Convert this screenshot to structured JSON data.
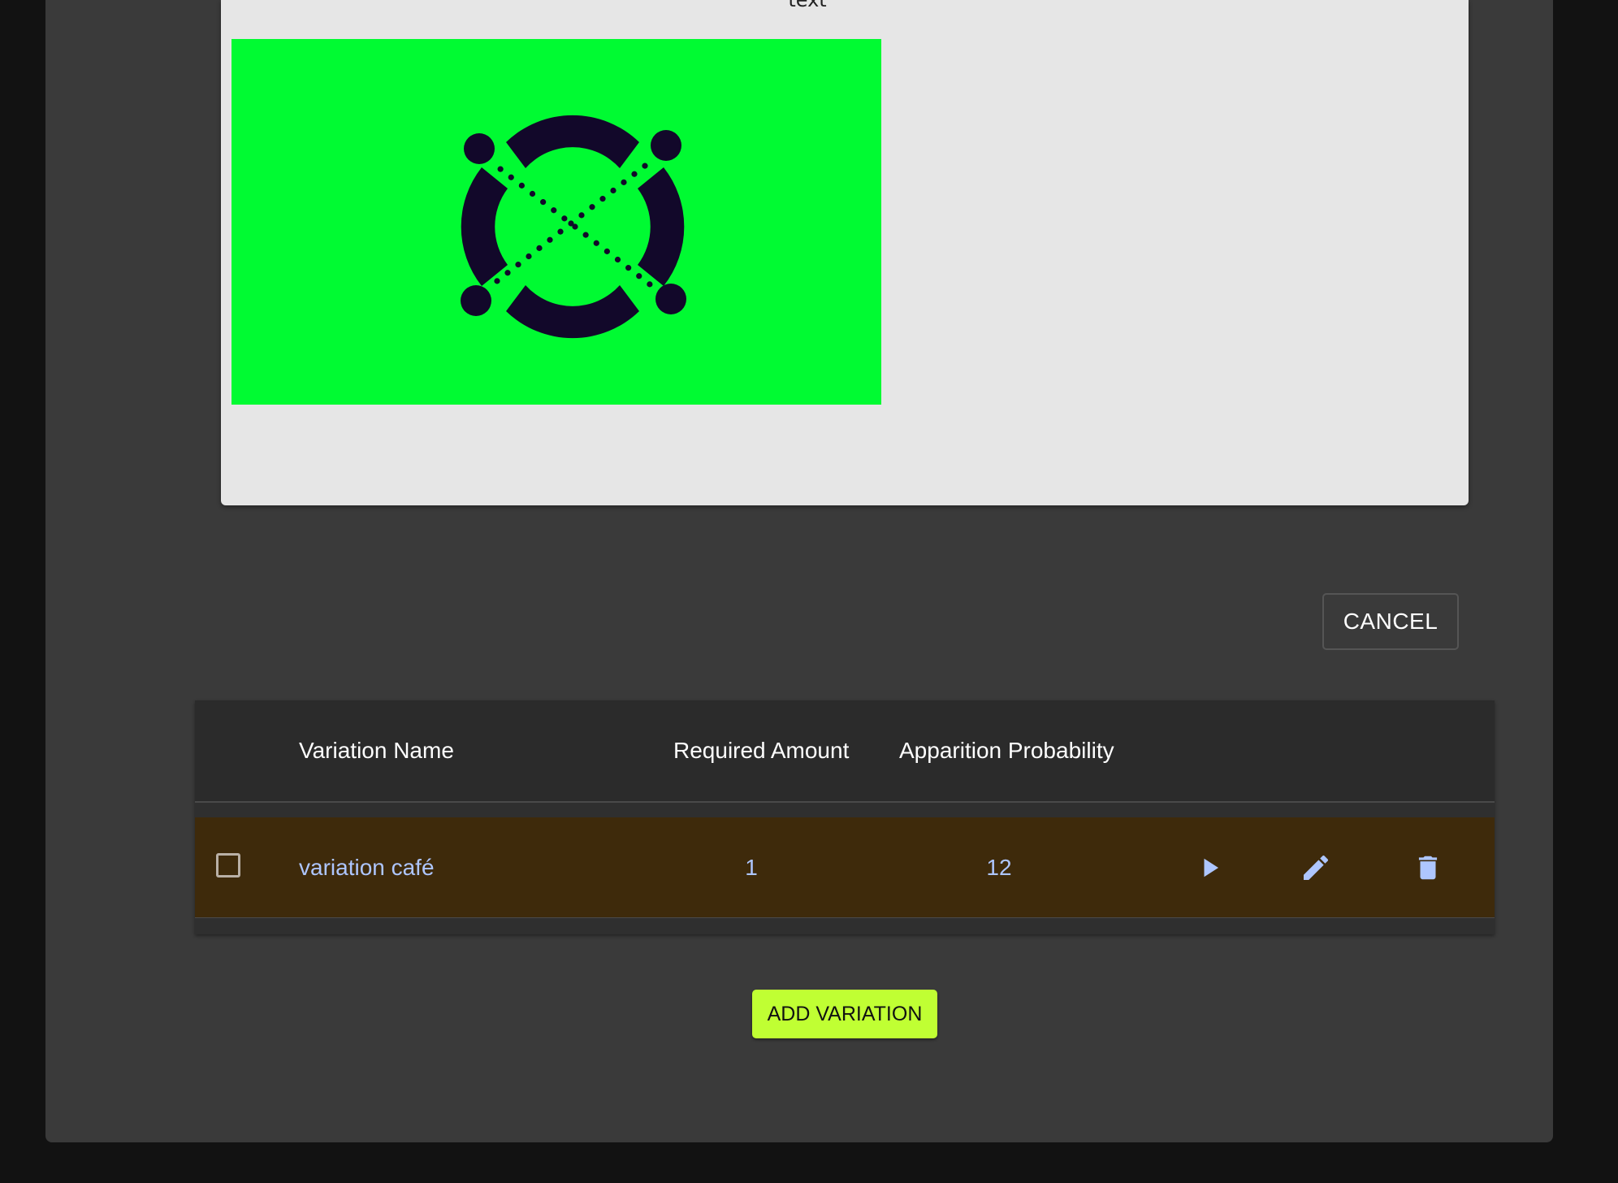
{
  "preview": {
    "caption": "text",
    "image_background": "#00fb32",
    "logo_color": "#12082a"
  },
  "actions": {
    "cancel_label": "CANCEL",
    "add_variation_label": "ADD VARIATION"
  },
  "table": {
    "columns": [
      "Variation Name",
      "Required Amount",
      "Apparition Probability"
    ],
    "rows": [
      {
        "name": "variation café",
        "required_amount": "1",
        "apparition_probability": "12",
        "icons": [
          "play-icon",
          "edit-icon",
          "delete-icon"
        ]
      }
    ]
  },
  "colors": {
    "background": "#121212",
    "panel": "#3a3a3a",
    "row_highlight": "#3e2a0b",
    "accent_text": "#aec6ff",
    "add_button": "#c0ff33"
  }
}
